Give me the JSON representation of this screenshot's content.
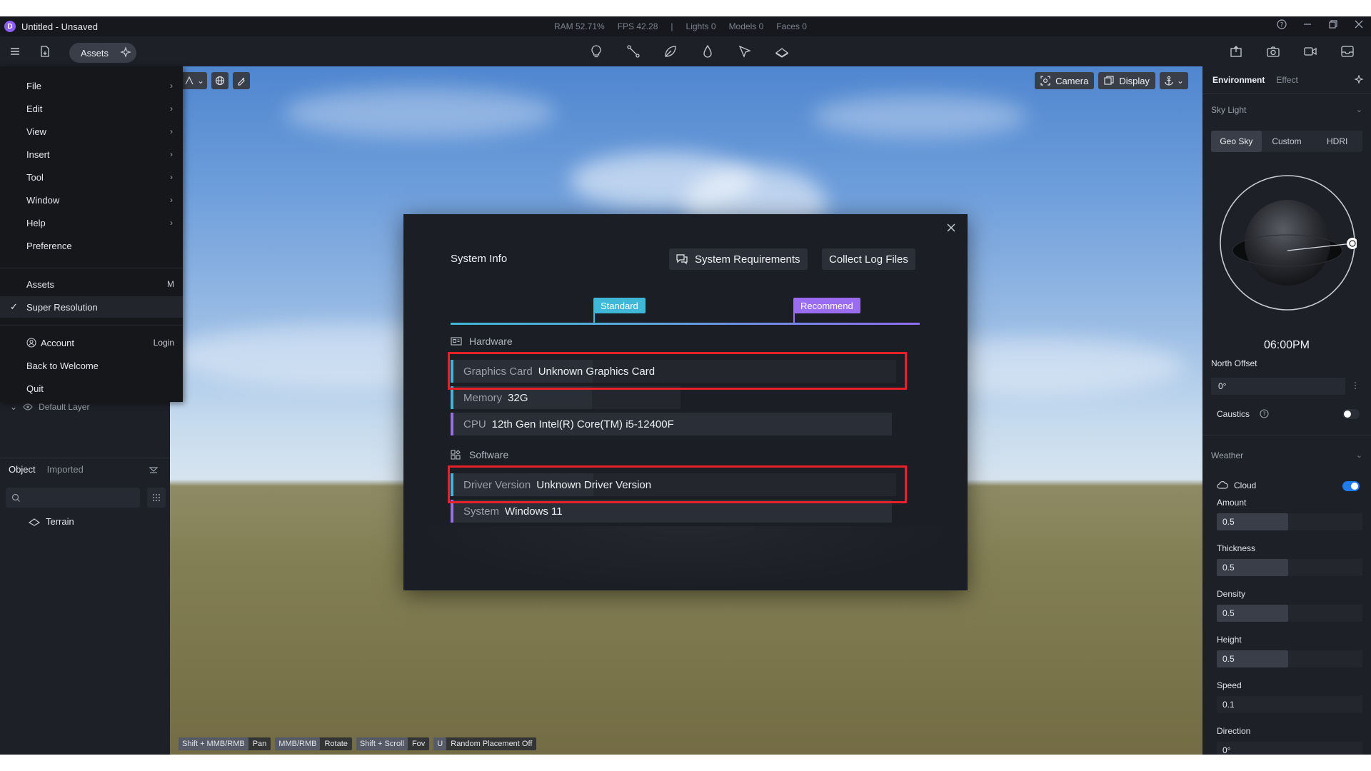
{
  "titlebar": {
    "logo_letter": "D",
    "title": "Untitled - Unsaved",
    "stats": [
      "RAM 52.71%",
      "FPS 42.28",
      "|",
      "Lights 0",
      "Models 0",
      "Faces 0"
    ]
  },
  "toolbar": {
    "assets_label": "Assets"
  },
  "menu": {
    "items": [
      {
        "label": "File",
        "arrow": "›"
      },
      {
        "label": "Edit",
        "arrow": "›"
      },
      {
        "label": "View",
        "arrow": "›"
      },
      {
        "label": "Insert",
        "arrow": "›"
      },
      {
        "label": "Tool",
        "arrow": "›"
      },
      {
        "label": "Window",
        "arrow": "›"
      },
      {
        "label": "Help",
        "arrow": "›"
      },
      {
        "label": "Preference"
      }
    ],
    "assets": {
      "label": "Assets",
      "shortcut": "M"
    },
    "super_resolution": {
      "label": "Super Resolution",
      "check": "✓"
    },
    "account": {
      "label": "Account",
      "action": "Login"
    },
    "back_to_welcome": "Back to Welcome",
    "quit": "Quit"
  },
  "leftpanel": {
    "layer_label": "Default Layer",
    "tabs": [
      "Object",
      "Imported"
    ],
    "search_placeholder": "",
    "tree": [
      {
        "label": "Terrain"
      }
    ]
  },
  "viewport": {
    "camera_label": "Camera",
    "display_label": "Display",
    "hints": [
      {
        "key": "Shift + MMB/RMB",
        "action": "Pan"
      },
      {
        "key": "MMB/RMB",
        "action": "Rotate"
      },
      {
        "key": "Shift + Scroll",
        "action": "Fov"
      },
      {
        "key": "U",
        "action": "Random Placement Off"
      }
    ]
  },
  "dialog": {
    "title": "System Info",
    "system_requirements_label": "System Requirements",
    "collect_logs_label": "Collect Log Files",
    "tier_standard": "Standard",
    "tier_recommend": "Recommend",
    "hardware_heading": "Hardware",
    "software_heading": "Software",
    "hardware": [
      {
        "key": "Graphics Card",
        "value": "Unknown Graphics Card"
      },
      {
        "key": "Memory",
        "value": "32G"
      },
      {
        "key": "CPU",
        "value": "12th Gen Intel(R) Core(TM) i5-12400F"
      }
    ],
    "software": [
      {
        "key": "Driver Version",
        "value": "Unknown Driver Version"
      },
      {
        "key": "System",
        "value": "Windows 11"
      }
    ]
  },
  "rightpanel": {
    "tabs": [
      "Environment",
      "Effect"
    ],
    "sky_light_label": "Sky Light",
    "sky_modes": [
      "Geo Sky",
      "Custom",
      "HDRI"
    ],
    "sky_mode_selected": "Geo Sky",
    "time": "06:00PM",
    "north_offset_label": "North Offset",
    "north_offset_value": "0°",
    "caustics_label": "Caustics",
    "caustics_on": false,
    "weather_label": "Weather",
    "cloud_label": "Cloud",
    "cloud_on": true,
    "sliders": [
      {
        "label": "Amount",
        "value": "0.5",
        "fraction": 0.5
      },
      {
        "label": "Thickness",
        "value": "0.5",
        "fraction": 0.5
      },
      {
        "label": "Density",
        "value": "0.5",
        "fraction": 0.5
      },
      {
        "label": "Height",
        "value": "0.5",
        "fraction": 0.5
      },
      {
        "label": "Speed",
        "value": "0.1",
        "fraction": 0.1
      },
      {
        "label": "Direction",
        "value": "0°",
        "fraction": 0.0
      }
    ]
  },
  "colors": {
    "accent_blue": "#1e7bf0",
    "standard_tag": "#3fb8d8",
    "recommend_tag": "#9a6cf0",
    "highlight_red": "#e8202a"
  }
}
